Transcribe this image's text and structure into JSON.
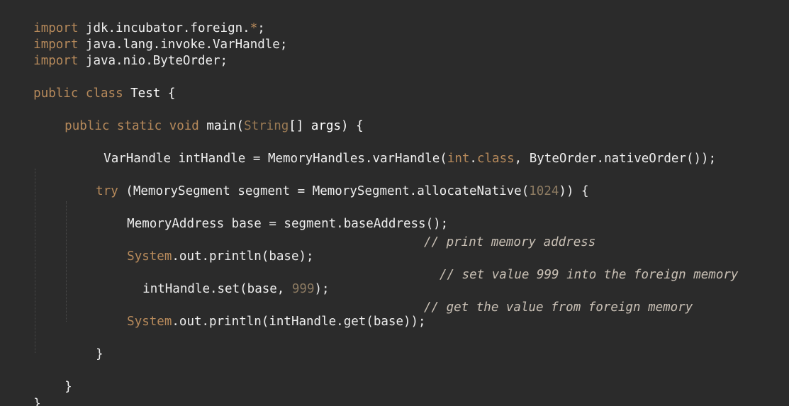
{
  "colors": {
    "background": "#2b2b2b",
    "keyword": "#b78a5b",
    "text": "#eeeeee",
    "number": "#8d7b62",
    "comment": "#c9c0b5"
  },
  "code": {
    "line1": {
      "kw": "import",
      "rest": " jdk.incubator.foreign.",
      "star": "*",
      "semi": ";"
    },
    "line2": {
      "kw": "import",
      "rest": " java.lang.invoke.VarHandle;"
    },
    "line3": {
      "kw": "import",
      "rest": " java.nio.ByteOrder;"
    },
    "line4": {
      "kw1": "public",
      "sp1": " ",
      "kw2": "class",
      "rest": " Test {"
    },
    "line5": {
      "kw1": "public",
      "sp1": " ",
      "kw2": "static",
      "sp2": " ",
      "kw3": "void",
      "name": " main(",
      "type": "String",
      "rest": "[] args) {"
    },
    "line6": {
      "pre": "VarHandle intHandle = MemoryHandles.varHandle(",
      "kw1": "int",
      "dot": ".",
      "kw2": "class",
      "post": ", ByteOrder.nativeOrder());"
    },
    "line7": {
      "kw": "try",
      "mid": " (MemorySegment segment = MemorySegment.allocateNative(",
      "num": "1024",
      "post": ")) {"
    },
    "line8": {
      "text": "MemoryAddress base = segment.baseAddress();"
    },
    "line9": {
      "cls": "System",
      "rest": ".out.println(base);",
      "comment": "// print memory address"
    },
    "line10": {
      "pre": "intHandle.set(base, ",
      "num": "999",
      "post": ");",
      "comment": "// set value 999 into the foreign memory"
    },
    "line11": {
      "cls": "System",
      "rest": ".out.println(intHandle.get(base));",
      "comment": "// get the value from foreign memory"
    },
    "line12": {
      "text": "}"
    },
    "line13": {
      "text": "}"
    },
    "line14": {
      "text": "}"
    }
  }
}
